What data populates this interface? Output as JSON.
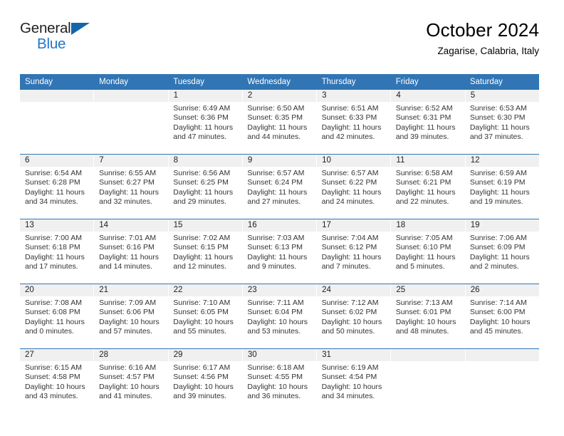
{
  "logo": {
    "word1": "General",
    "word2": "Blue",
    "triangle_color": "#1266ad",
    "text_color": "#231f20",
    "blue_color": "#2176c7"
  },
  "header": {
    "title": "October 2024",
    "subtitle": "Zagarise, Calabria, Italy"
  },
  "theme": {
    "header_blue": "#3175b4",
    "daynum_band": "#f0f0f0",
    "text": "#333333"
  },
  "weekdays": [
    "Sunday",
    "Monday",
    "Tuesday",
    "Wednesday",
    "Thursday",
    "Friday",
    "Saturday"
  ],
  "weeks": [
    [
      {
        "day": "",
        "lines": []
      },
      {
        "day": "",
        "lines": []
      },
      {
        "day": "1",
        "lines": [
          "Sunrise: 6:49 AM",
          "Sunset: 6:36 PM",
          "Daylight: 11 hours",
          "and 47 minutes."
        ]
      },
      {
        "day": "2",
        "lines": [
          "Sunrise: 6:50 AM",
          "Sunset: 6:35 PM",
          "Daylight: 11 hours",
          "and 44 minutes."
        ]
      },
      {
        "day": "3",
        "lines": [
          "Sunrise: 6:51 AM",
          "Sunset: 6:33 PM",
          "Daylight: 11 hours",
          "and 42 minutes."
        ]
      },
      {
        "day": "4",
        "lines": [
          "Sunrise: 6:52 AM",
          "Sunset: 6:31 PM",
          "Daylight: 11 hours",
          "and 39 minutes."
        ]
      },
      {
        "day": "5",
        "lines": [
          "Sunrise: 6:53 AM",
          "Sunset: 6:30 PM",
          "Daylight: 11 hours",
          "and 37 minutes."
        ]
      }
    ],
    [
      {
        "day": "6",
        "lines": [
          "Sunrise: 6:54 AM",
          "Sunset: 6:28 PM",
          "Daylight: 11 hours",
          "and 34 minutes."
        ]
      },
      {
        "day": "7",
        "lines": [
          "Sunrise: 6:55 AM",
          "Sunset: 6:27 PM",
          "Daylight: 11 hours",
          "and 32 minutes."
        ]
      },
      {
        "day": "8",
        "lines": [
          "Sunrise: 6:56 AM",
          "Sunset: 6:25 PM",
          "Daylight: 11 hours",
          "and 29 minutes."
        ]
      },
      {
        "day": "9",
        "lines": [
          "Sunrise: 6:57 AM",
          "Sunset: 6:24 PM",
          "Daylight: 11 hours",
          "and 27 minutes."
        ]
      },
      {
        "day": "10",
        "lines": [
          "Sunrise: 6:57 AM",
          "Sunset: 6:22 PM",
          "Daylight: 11 hours",
          "and 24 minutes."
        ]
      },
      {
        "day": "11",
        "lines": [
          "Sunrise: 6:58 AM",
          "Sunset: 6:21 PM",
          "Daylight: 11 hours",
          "and 22 minutes."
        ]
      },
      {
        "day": "12",
        "lines": [
          "Sunrise: 6:59 AM",
          "Sunset: 6:19 PM",
          "Daylight: 11 hours",
          "and 19 minutes."
        ]
      }
    ],
    [
      {
        "day": "13",
        "lines": [
          "Sunrise: 7:00 AM",
          "Sunset: 6:18 PM",
          "Daylight: 11 hours",
          "and 17 minutes."
        ]
      },
      {
        "day": "14",
        "lines": [
          "Sunrise: 7:01 AM",
          "Sunset: 6:16 PM",
          "Daylight: 11 hours",
          "and 14 minutes."
        ]
      },
      {
        "day": "15",
        "lines": [
          "Sunrise: 7:02 AM",
          "Sunset: 6:15 PM",
          "Daylight: 11 hours",
          "and 12 minutes."
        ]
      },
      {
        "day": "16",
        "lines": [
          "Sunrise: 7:03 AM",
          "Sunset: 6:13 PM",
          "Daylight: 11 hours",
          "and 9 minutes."
        ]
      },
      {
        "day": "17",
        "lines": [
          "Sunrise: 7:04 AM",
          "Sunset: 6:12 PM",
          "Daylight: 11 hours",
          "and 7 minutes."
        ]
      },
      {
        "day": "18",
        "lines": [
          "Sunrise: 7:05 AM",
          "Sunset: 6:10 PM",
          "Daylight: 11 hours",
          "and 5 minutes."
        ]
      },
      {
        "day": "19",
        "lines": [
          "Sunrise: 7:06 AM",
          "Sunset: 6:09 PM",
          "Daylight: 11 hours",
          "and 2 minutes."
        ]
      }
    ],
    [
      {
        "day": "20",
        "lines": [
          "Sunrise: 7:08 AM",
          "Sunset: 6:08 PM",
          "Daylight: 11 hours",
          "and 0 minutes."
        ]
      },
      {
        "day": "21",
        "lines": [
          "Sunrise: 7:09 AM",
          "Sunset: 6:06 PM",
          "Daylight: 10 hours",
          "and 57 minutes."
        ]
      },
      {
        "day": "22",
        "lines": [
          "Sunrise: 7:10 AM",
          "Sunset: 6:05 PM",
          "Daylight: 10 hours",
          "and 55 minutes."
        ]
      },
      {
        "day": "23",
        "lines": [
          "Sunrise: 7:11 AM",
          "Sunset: 6:04 PM",
          "Daylight: 10 hours",
          "and 53 minutes."
        ]
      },
      {
        "day": "24",
        "lines": [
          "Sunrise: 7:12 AM",
          "Sunset: 6:02 PM",
          "Daylight: 10 hours",
          "and 50 minutes."
        ]
      },
      {
        "day": "25",
        "lines": [
          "Sunrise: 7:13 AM",
          "Sunset: 6:01 PM",
          "Daylight: 10 hours",
          "and 48 minutes."
        ]
      },
      {
        "day": "26",
        "lines": [
          "Sunrise: 7:14 AM",
          "Sunset: 6:00 PM",
          "Daylight: 10 hours",
          "and 45 minutes."
        ]
      }
    ],
    [
      {
        "day": "27",
        "lines": [
          "Sunrise: 6:15 AM",
          "Sunset: 4:58 PM",
          "Daylight: 10 hours",
          "and 43 minutes."
        ]
      },
      {
        "day": "28",
        "lines": [
          "Sunrise: 6:16 AM",
          "Sunset: 4:57 PM",
          "Daylight: 10 hours",
          "and 41 minutes."
        ]
      },
      {
        "day": "29",
        "lines": [
          "Sunrise: 6:17 AM",
          "Sunset: 4:56 PM",
          "Daylight: 10 hours",
          "and 39 minutes."
        ]
      },
      {
        "day": "30",
        "lines": [
          "Sunrise: 6:18 AM",
          "Sunset: 4:55 PM",
          "Daylight: 10 hours",
          "and 36 minutes."
        ]
      },
      {
        "day": "31",
        "lines": [
          "Sunrise: 6:19 AM",
          "Sunset: 4:54 PM",
          "Daylight: 10 hours",
          "and 34 minutes."
        ]
      },
      {
        "day": "",
        "lines": []
      },
      {
        "day": "",
        "lines": []
      }
    ]
  ]
}
